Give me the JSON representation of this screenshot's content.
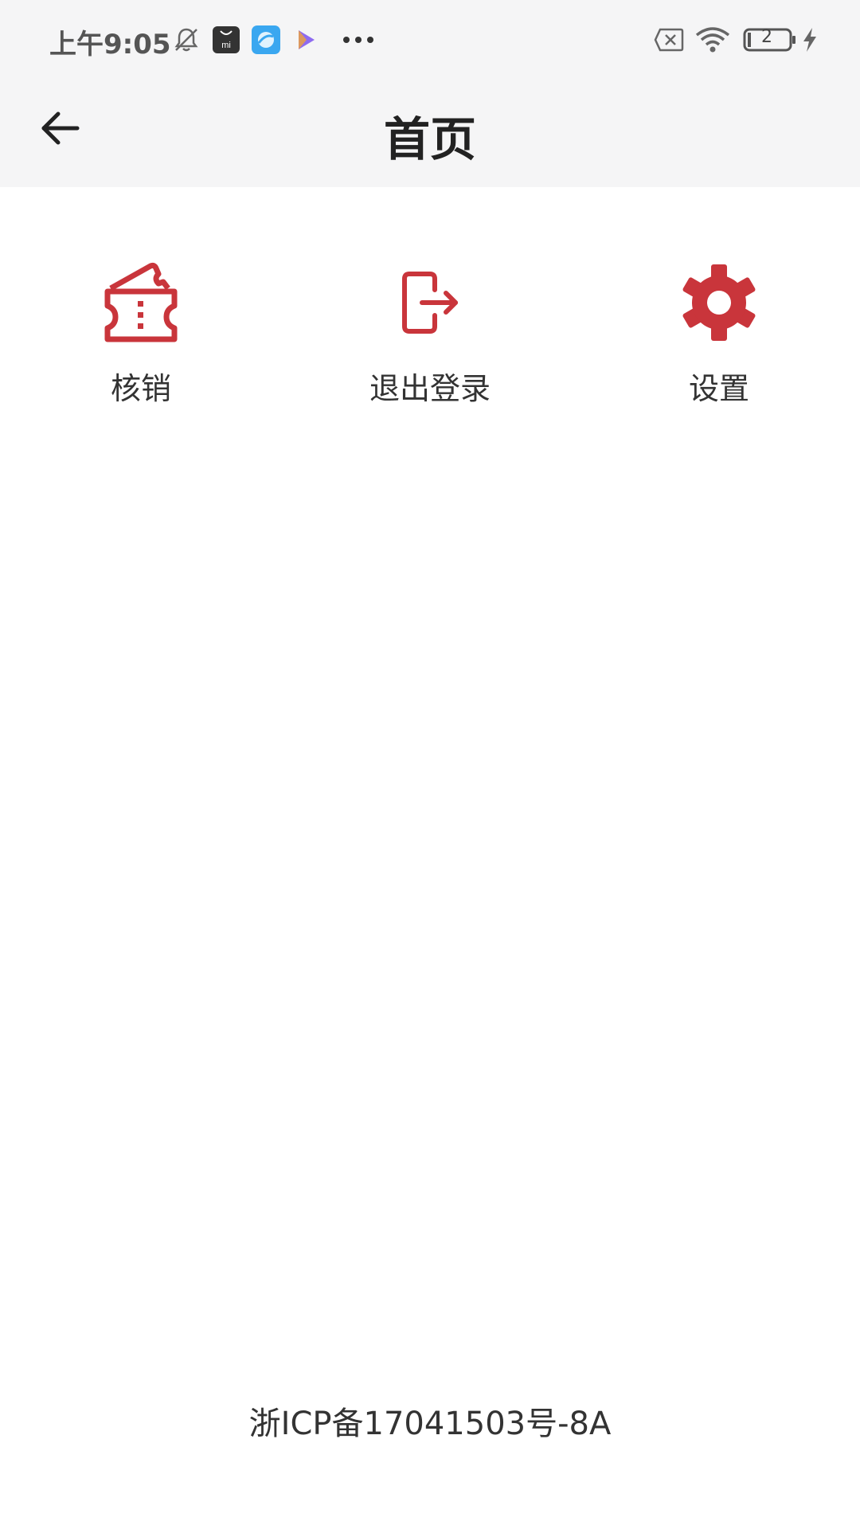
{
  "status_bar": {
    "time": "上午9:05",
    "icons": [
      "bell-off-icon",
      "mi-store-icon",
      "browser-app-icon",
      "video-play-icon",
      "more-dots-icon",
      "sim-x-icon",
      "wifi-icon",
      "battery-icon",
      "charging-bolt-icon"
    ],
    "battery_level": "2"
  },
  "app_bar": {
    "title": "首页",
    "back_icon": "arrow-left-icon"
  },
  "actions": [
    {
      "label": "核销",
      "icon": "ticket-icon"
    },
    {
      "label": "退出登录",
      "icon": "logout-icon"
    },
    {
      "label": "设置",
      "icon": "gear-icon"
    }
  ],
  "footer": {
    "icp_text": "浙ICP备17041503号-8A"
  },
  "colors": {
    "accent": "#c9353b",
    "top_background": "#f5f5f6",
    "title_text": "#222222",
    "status_text": "#555555"
  }
}
